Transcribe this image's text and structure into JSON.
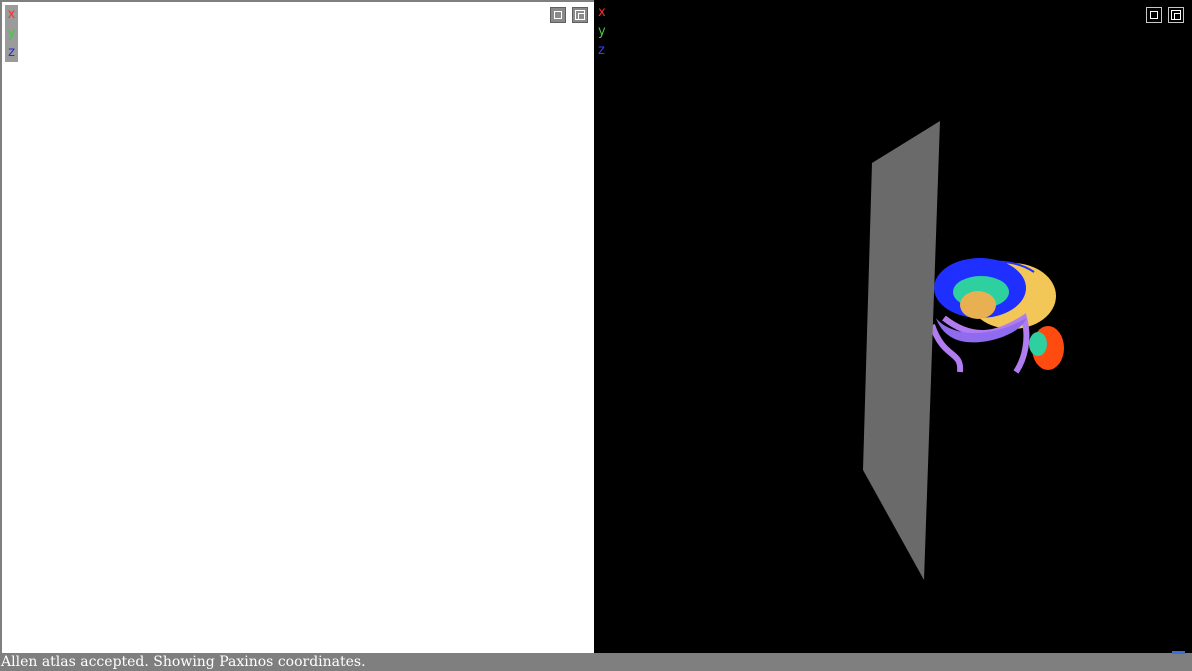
{
  "left_view": {
    "axes": {
      "x": "x",
      "y": "y",
      "z": "z"
    },
    "buttons": {
      "maximize_icon": "maximize-icon",
      "restore_icon": "restore-icon"
    }
  },
  "right_view": {
    "axes": {
      "x": "x",
      "y": "y",
      "z": "z"
    },
    "buttons": {
      "maximize_icon": "maximize-icon",
      "restore_icon": "restore-icon"
    },
    "scene": {
      "slice_plane_color": "#6a6a6a",
      "brain_colors": [
        "#f2c657",
        "#1f2fff",
        "#2ed0a0",
        "#b07cf0",
        "#ff4a10",
        "#e8b050"
      ]
    }
  },
  "status_bar": {
    "message": "Allen atlas accepted. Showing Paxinos coordinates."
  }
}
